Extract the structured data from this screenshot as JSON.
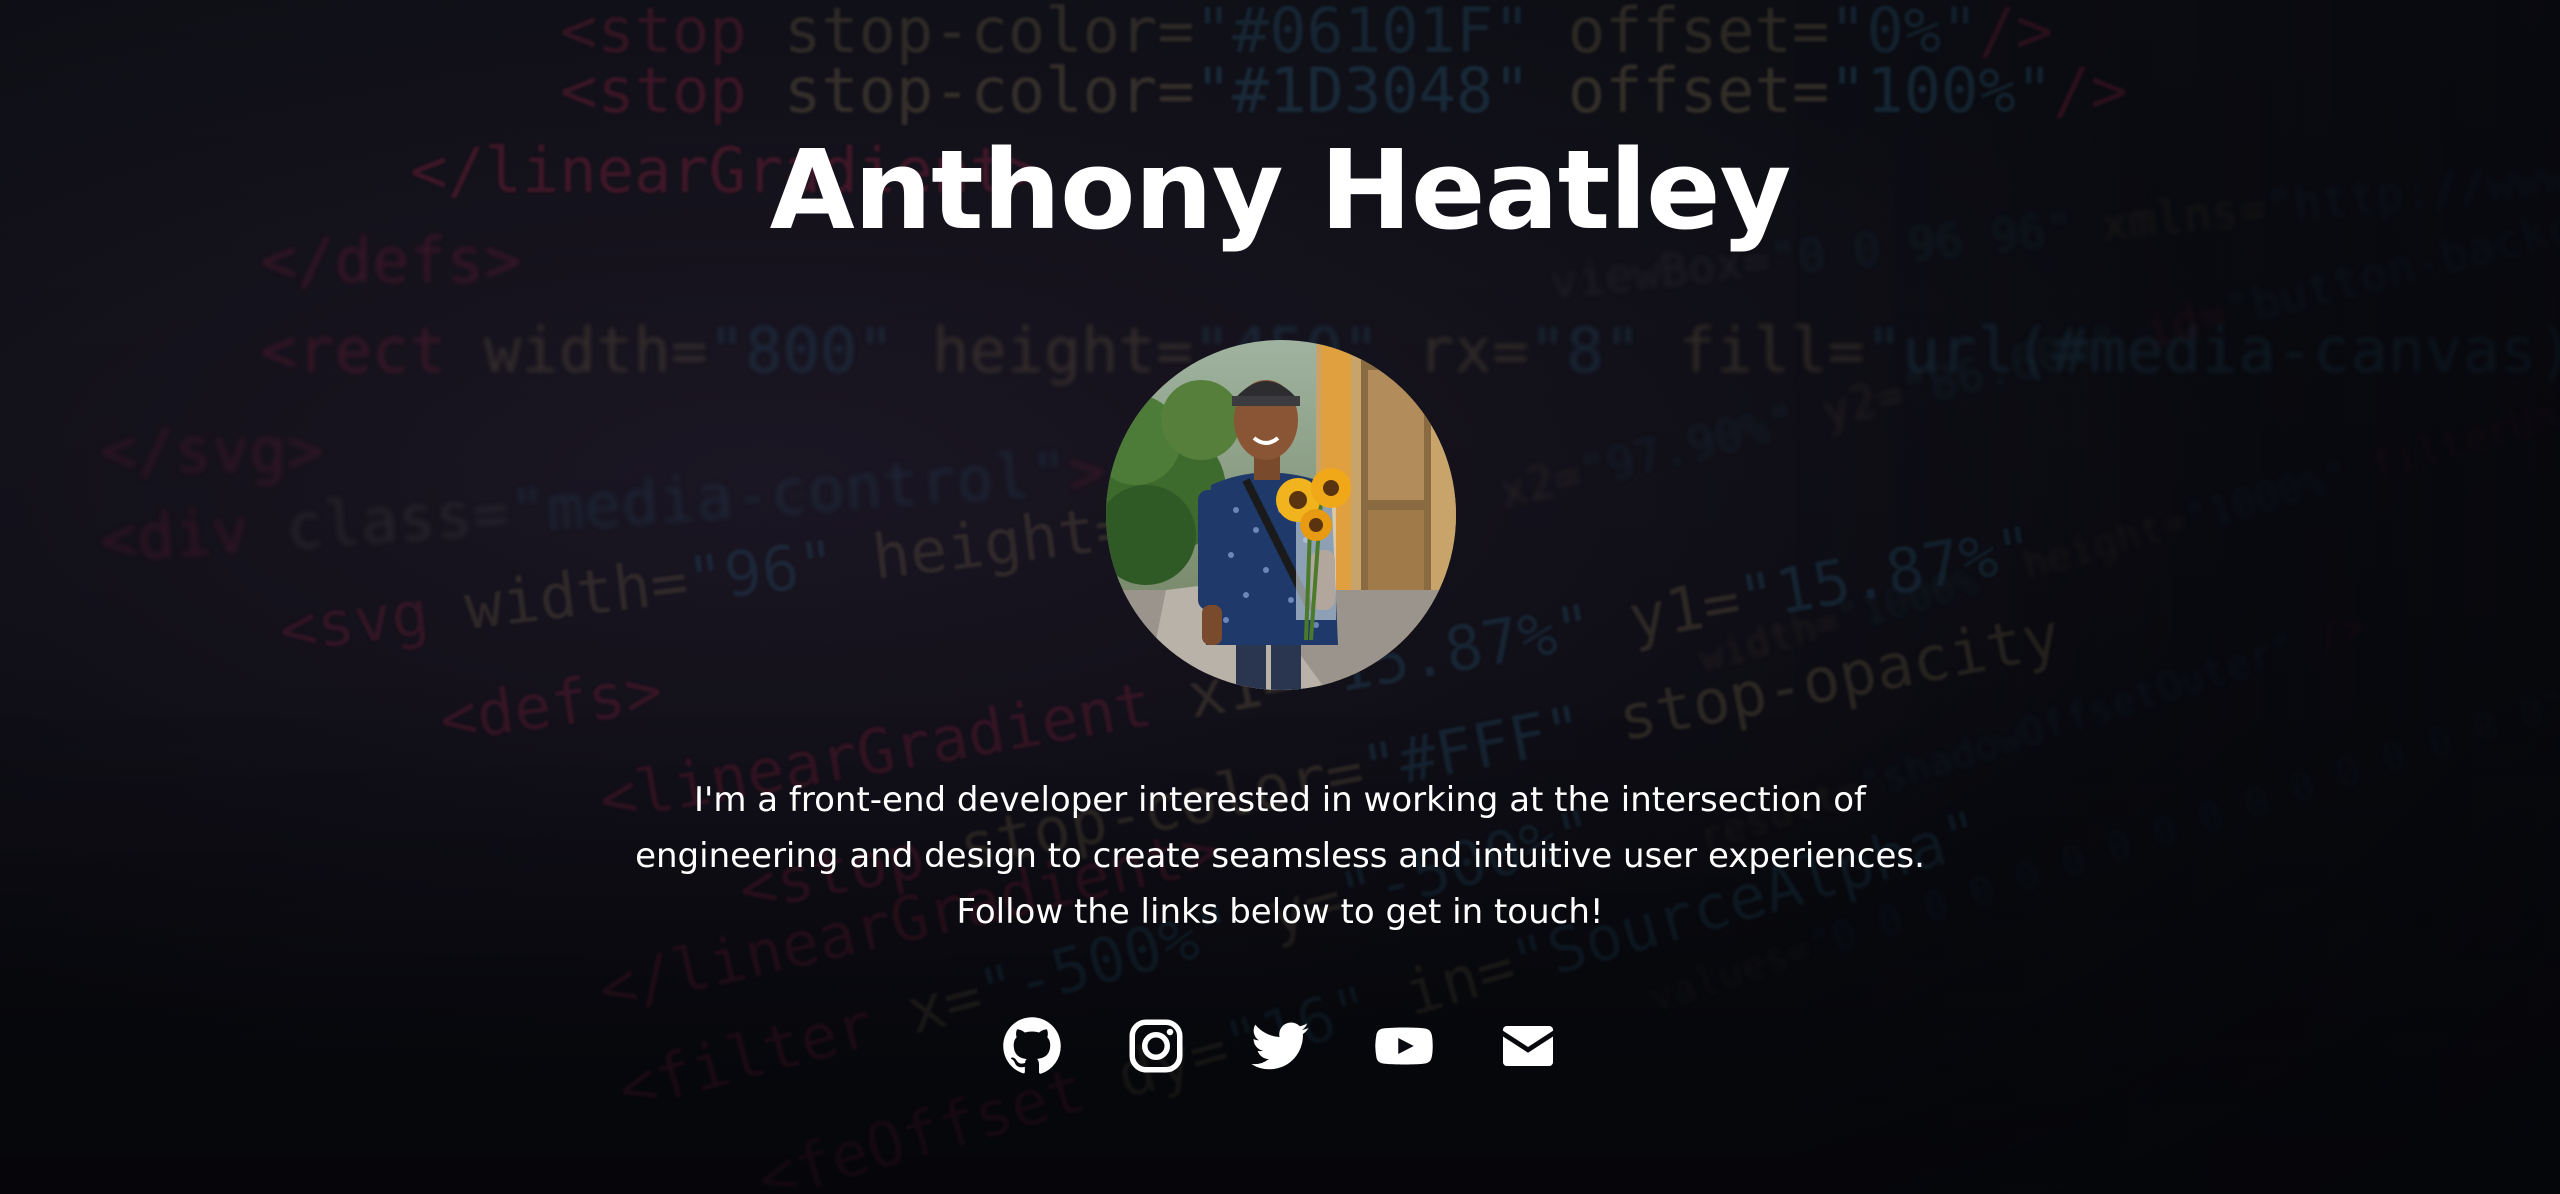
{
  "profile": {
    "name": "Anthony Heatley",
    "bio_lines": [
      "I'm a front-end developer interested in working at the intersection of",
      "engineering and design to create seamsless and intuitive user experiences.",
      "Follow the links below to get in touch!"
    ]
  },
  "social_links": [
    {
      "name": "github",
      "icon": "github-icon"
    },
    {
      "name": "instagram",
      "icon": "instagram-icon"
    },
    {
      "name": "twitter",
      "icon": "twitter-icon"
    },
    {
      "name": "youtube",
      "icon": "youtube-icon"
    },
    {
      "name": "email",
      "icon": "envelope-icon"
    }
  ],
  "background_code": [
    "<stop stop-color=\"#06101F\" offset=\"0%\"/>",
    "<stop stop-color=\"#1D3048\" offset=\"100%\"/>",
    "</linearGradient>",
    "</defs>",
    "<rect width=\"800\" height=\"450\" rx=\"8\" fill=\"url(#media-canvas)\" fill-rule=\"evenodd\"/>",
    "</svg>",
    "<div class=\"media-control\">",
    "<svg width=\"96\" height=\"96\" viewBox=\"0 0 96 96\" xmlns=\"http://www.w3.org/2000/svg\">",
    "<defs>",
    "<linearGradient x1=\"15.87%\" y1=\"15.87%\" x2=\"97.90%\" y2=\"86.60%\" id=\"button-background\">",
    "<stop stop-color=\"#FFF\" stop-opacity=\"0\" offset=\"0%\"/>",
    "<stop stop-color=\"#FFF\" offset=\"100%\"/>",
    "</linearGradient>",
    "<filter x=\"-500%\" y=\"-500%\" width=\"1000%\" height=\"1000%\" filterUnits=\"objectBoundingBox\" id=\"dropshadow-1\">",
    "<feOffset dy=\"16\" in=\"SourceAlpha\" result=\"shadowOffsetOuter\"/>",
    "<feGaussianBlur stdDeviation=\"24\" in=\"shadowOffsetOuter\" result=\"shadowBlurOuter\"/>",
    "<feColorMatrix values=\"0 0 0 0 0 0 0 0 0 0 0 0 0 0 0 0 0 0 0.2 0\" in=\"shadowBlurOuter\"/>"
  ]
}
